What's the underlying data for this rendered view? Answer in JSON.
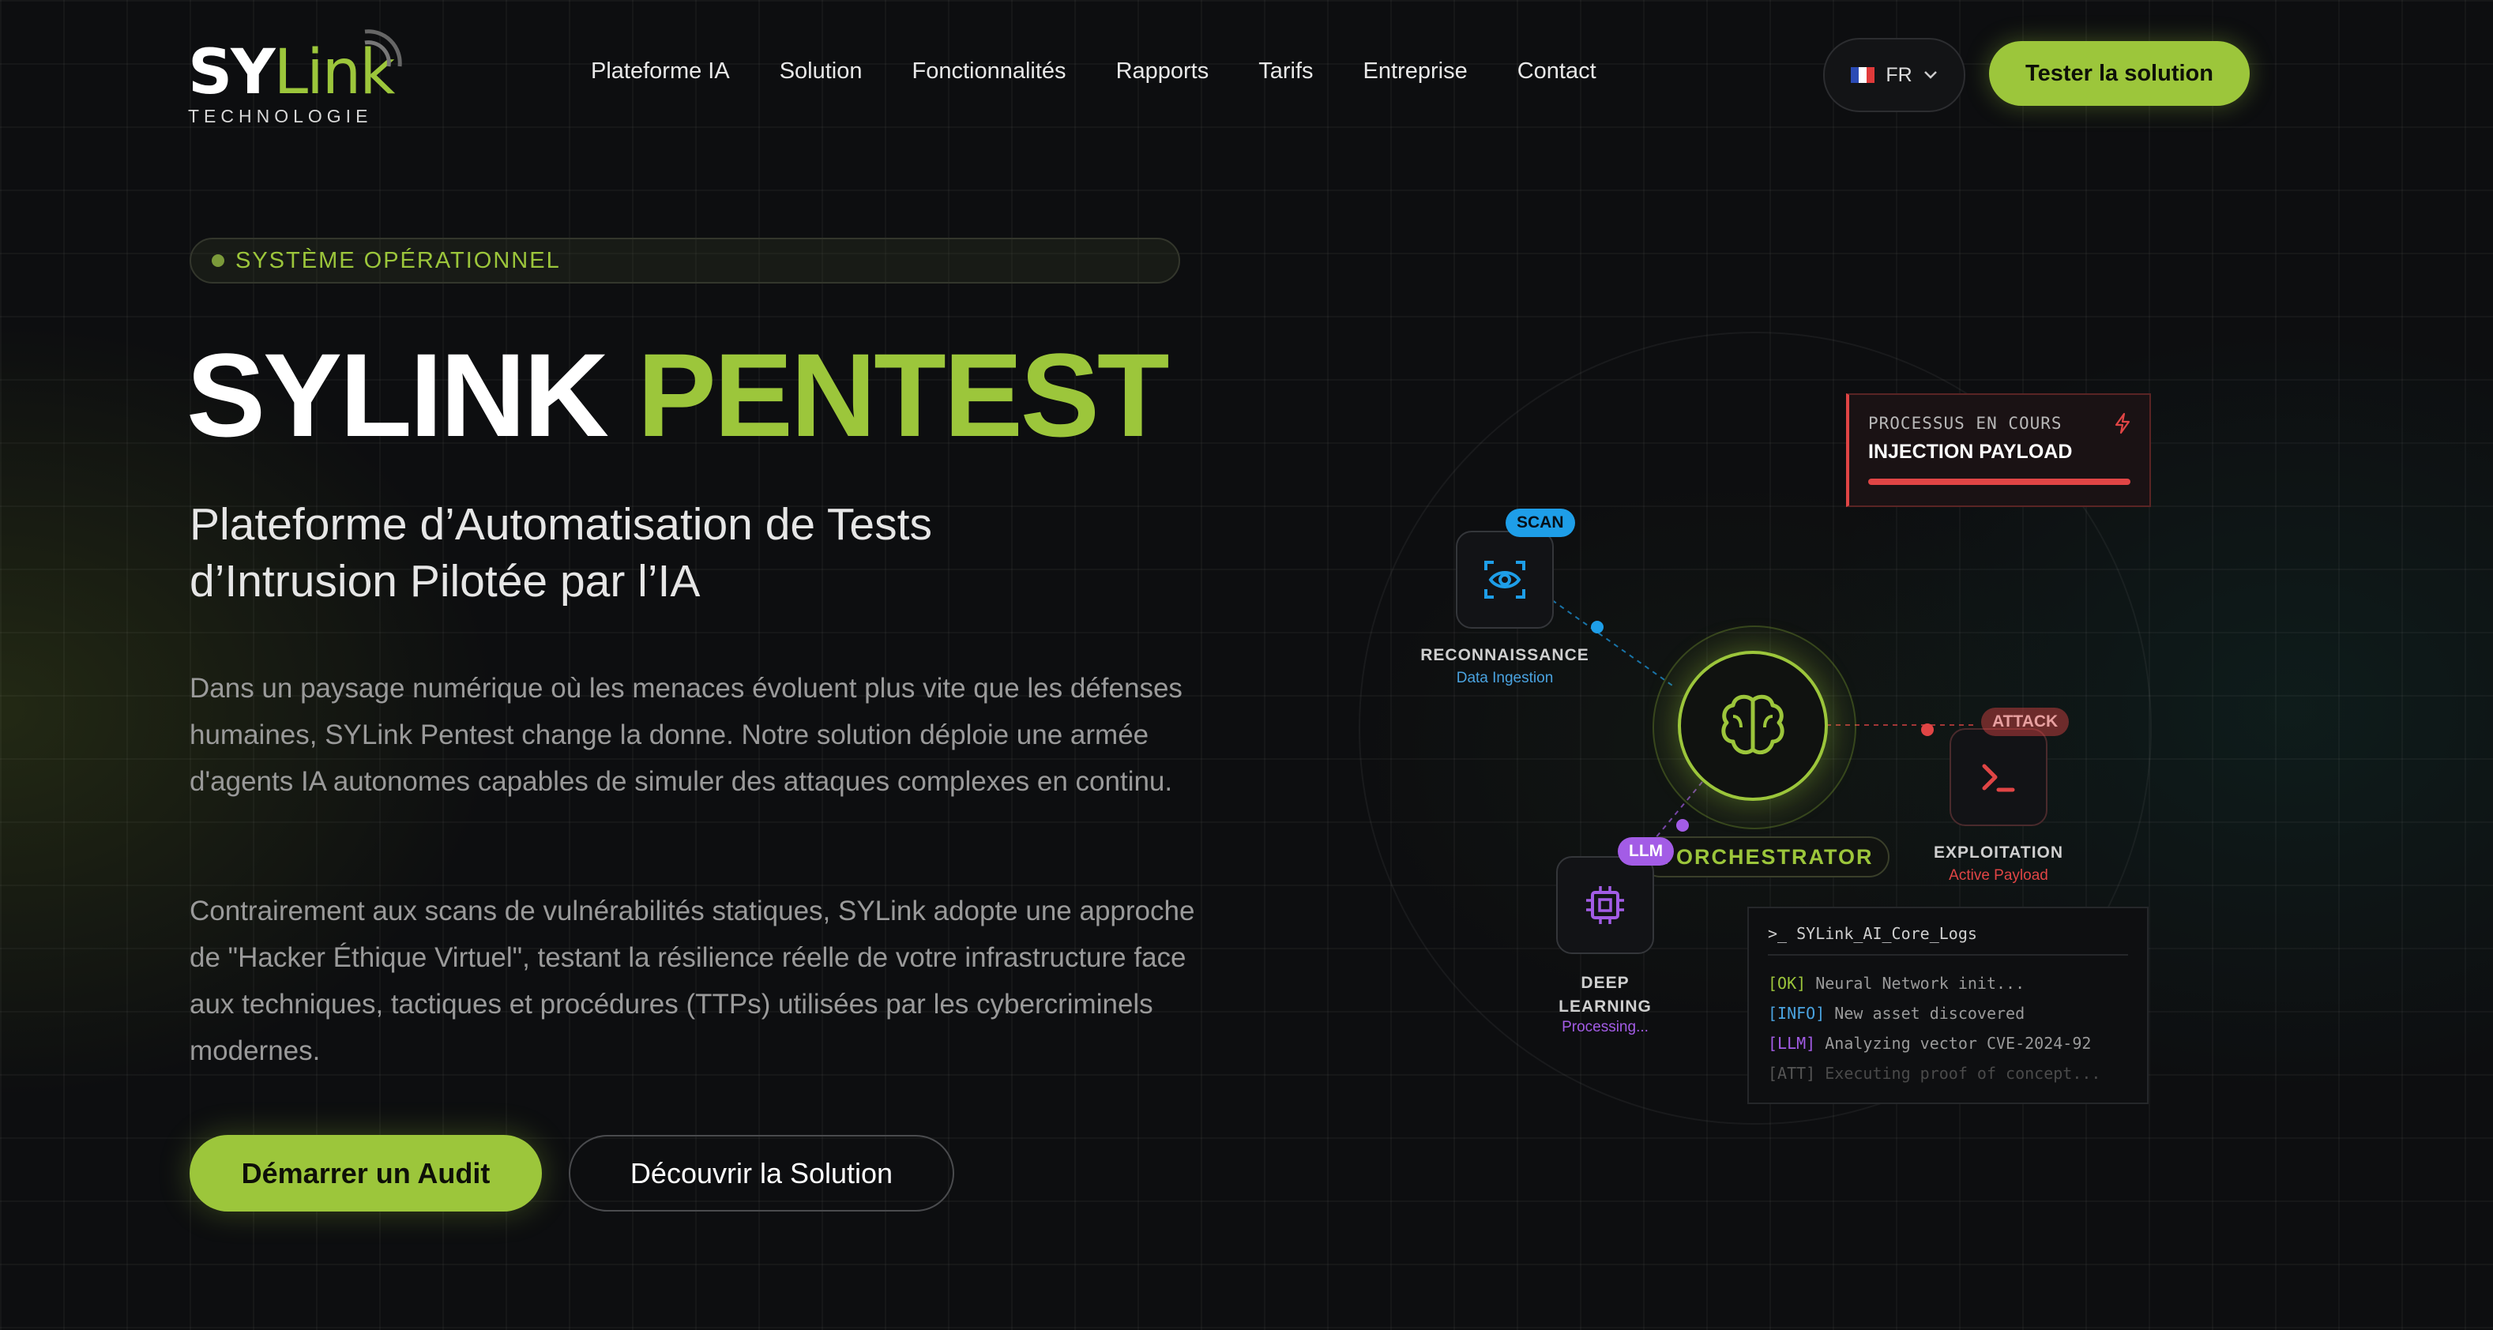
{
  "brand": {
    "logo_main_a": "SY",
    "logo_main_b": "Link",
    "logo_sub": "TECHNOLOGIE"
  },
  "nav": {
    "items": [
      "Plateforme IA",
      "Solution",
      "Fonctionnalités",
      "Rapports",
      "Tarifs",
      "Entreprise",
      "Contact"
    ]
  },
  "lang": {
    "code": "FR"
  },
  "header": {
    "cta_label": "Tester la solution"
  },
  "hero": {
    "status_label": "SYSTÈME OPÉRATIONNEL",
    "title_white": "SYLINK",
    "title_green": "PENTEST",
    "subtitle": "Plateforme d’Automatisation de Tests d’Intrusion Pilotée par l’IA",
    "paragraph1": "Dans un paysage numérique où les menaces évoluent plus vite que les défenses humaines, SYLink Pentest change la donne. Notre solution déploie une armée d'agents IA autonomes capables de simuler des attaques complexes en continu.",
    "paragraph2": "Contrairement aux scans de vulnérabilités statiques, SYLink adopte une approche de \"Hacker Éthique Virtuel\", testant la résilience réelle de votre infrastructure face aux techniques, tactiques et procédures (TTPs) utilisées par les cybercriminels modernes.",
    "primary_button": "Démarrer un Audit",
    "secondary_button": "Découvrir la Solution"
  },
  "diagram": {
    "process": {
      "label": "PROCESSUS EN COURS",
      "value": "INJECTION PAYLOAD"
    },
    "orchestrator_label": "A ORCHESTRATOR",
    "nodes": {
      "recon": {
        "tag": "SCAN",
        "label": "RECONNAISSANCE",
        "sub": "Data Ingestion"
      },
      "exploit": {
        "tag": "ATTACK",
        "label": "EXPLOITATION",
        "sub": "Active Payload"
      },
      "deep": {
        "tag": "LLM",
        "label_line1": "DEEP",
        "label_line2": "LEARNING",
        "sub": "Processing..."
      }
    },
    "colors": {
      "accent": "#9cc63b",
      "scan": "#1e9ee8",
      "attack": "#e04545",
      "llm": "#a35ce6"
    },
    "logs": {
      "title": "SYLink_AI_Core_Logs",
      "lines": [
        {
          "tag": "[OK]",
          "text": "Neural Network init..."
        },
        {
          "tag": "[INFO]",
          "text": "New asset discovered"
        },
        {
          "tag": "[LLM]",
          "text": "Analyzing vector CVE-2024-92"
        },
        {
          "tag": "[ATT]",
          "text": "Executing proof of concept..."
        }
      ]
    }
  }
}
